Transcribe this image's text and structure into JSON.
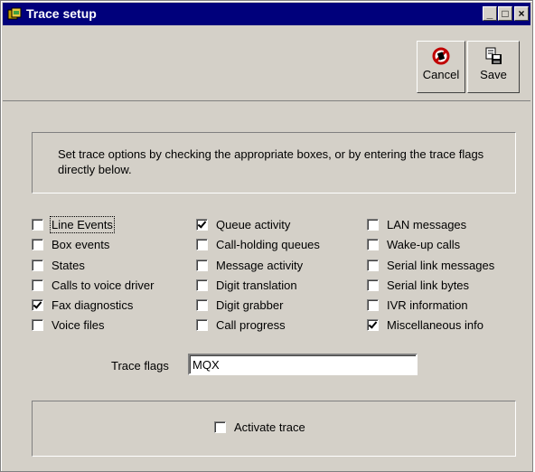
{
  "window": {
    "title": "Trace setup"
  },
  "titlebar_buttons": {
    "minimize": "_",
    "maximize": "□",
    "close": "×"
  },
  "toolbar": {
    "cancel_label": "Cancel",
    "save_label": "Save"
  },
  "info": {
    "text": "Set trace options by checking the appropriate boxes, or by entering the trace flags directly below."
  },
  "options": {
    "col1": [
      {
        "label": "Line Events",
        "checked": false
      },
      {
        "label": "Box events",
        "checked": false
      },
      {
        "label": "States",
        "checked": false
      },
      {
        "label": "Calls to voice driver",
        "checked": false
      },
      {
        "label": "Fax diagnostics",
        "checked": true
      },
      {
        "label": "Voice files",
        "checked": false
      }
    ],
    "col2": [
      {
        "label": "Queue activity",
        "checked": true
      },
      {
        "label": "Call-holding queues",
        "checked": false
      },
      {
        "label": "Message activity",
        "checked": false
      },
      {
        "label": "Digit translation",
        "checked": false
      },
      {
        "label": "Digit grabber",
        "checked": false
      },
      {
        "label": "Call progress",
        "checked": false
      }
    ],
    "col3": [
      {
        "label": "LAN messages",
        "checked": false
      },
      {
        "label": "Wake-up calls",
        "checked": false
      },
      {
        "label": "Serial link messages",
        "checked": false
      },
      {
        "label": "Serial link bytes",
        "checked": false
      },
      {
        "label": "IVR information",
        "checked": false
      },
      {
        "label": "Miscellaneous info",
        "checked": true
      }
    ]
  },
  "trace_flags": {
    "label": "Trace flags",
    "value": "MQX"
  },
  "activate": {
    "label": "Activate trace",
    "checked": false
  }
}
